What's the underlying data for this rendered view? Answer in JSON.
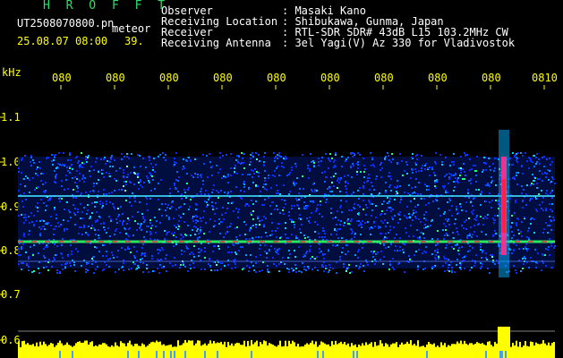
{
  "app_title": "H R O F F T",
  "file_name": "UT2508070800.pn",
  "meteor_label": "meteor",
  "date_time": "25.08.07 08:00",
  "count_value": "39.",
  "header_rows": [
    {
      "label": "Observer",
      "value": ": Masaki Kano"
    },
    {
      "label": "Receiving Location",
      "value": ": Shibukawa, Gunma, Japan"
    },
    {
      "label": "Receiver",
      "value": ": RTL-SDR SDR# 43dB L15 103.2MHz CW"
    },
    {
      "label": "Receiving Antenna",
      "value": ": 3el Yagi(V) Az 330 for Vladivostok"
    }
  ],
  "y_axis_unit": "kHz",
  "time_ticks": [
    "080",
    "080",
    "080",
    "080",
    "080",
    "080",
    "080",
    "080",
    "080",
    "0810"
  ],
  "freq_ticks": [
    "1.1",
    "1.0",
    "0.9",
    "0.8",
    "0.7",
    "0.6"
  ],
  "colors": {
    "title_green": "#27e36b",
    "text_white": "#ffffff",
    "axis_yellow": "#ffff00",
    "noise_blue": "#0a2cff",
    "carrier_red": "#ff2040",
    "meteor_magenta": "#ff3090"
  }
}
